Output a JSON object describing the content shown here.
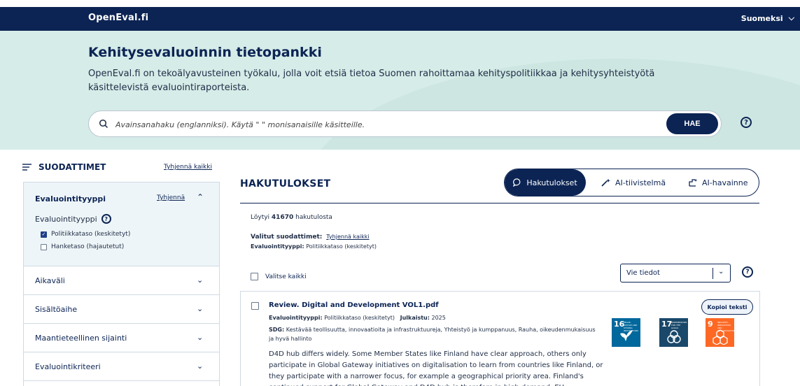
{
  "header": {
    "brand": "OpenEval.fi",
    "language": "Suomeksi"
  },
  "hero": {
    "title": "Kehitysevaluoinnin tietopankki",
    "description": "OpenEval.fi on tekoälyavusteinen työkalu, jolla voit etsiä tietoa Suomen rahoittamaa kehityspolitiikkaa ja kehitysyhteistyötä käsittelevistä evaluointiraporteista.",
    "search_placeholder": "Avainsanahaku (englanniksi). Käytä \" \" monisanaisille käsitteille.",
    "search_button": "HAE"
  },
  "filters": {
    "heading": "SUODATTIMET",
    "clear_all": "Tyhjennä kaikki",
    "open_section": {
      "title": "Evaluointityyppi",
      "clear": "Tyhjennä",
      "sub_label": "Evaluointityyppi",
      "options": [
        {
          "label": "Politiikkataso (keskitetyt)",
          "checked": true
        },
        {
          "label": "Hanketaso (hajautetut)",
          "checked": false
        }
      ]
    },
    "sections": [
      "Aikaväli",
      "Sisältöaihe",
      "Maantieteellinen sijainti",
      "Evaluointikriteeri"
    ]
  },
  "results": {
    "title": "HAKUTULOKSET",
    "tabs": [
      "Hakutulokset",
      "AI-tiivistelmä",
      "AI-havainne"
    ],
    "found_prefix": "Löytyi",
    "found_count": "41670",
    "found_suffix": "hakutulosta",
    "selected_label": "Valitut suodattimet:",
    "selected_clear": "Tyhjennä kaikki",
    "selected_type_label": "Evaluointityyppi:",
    "selected_type_value": "Politiikkataso (keskitetyt)",
    "select_all": "Valitse kaikki",
    "export_value": "Vie tiedot",
    "card": {
      "title": "Review. Digital and Development VOL1.pdf",
      "type_label": "Evaluointityyppi:",
      "type_value": "Politiikkataso (keskitetyt)",
      "published_label": "Julkaistu:",
      "published_value": "2025",
      "sdg_label": "SDG:",
      "sdg_value": "Kestävää teollisuutta, innovaatioita ja infrastruktuureja, Yhteistyö ja kumppanuus, Rauha, oikeudenmukaisuus ja hyvä hallinto",
      "copy_button": "Kopioi teksti",
      "body": "D4D hub differs widely. Some Member States like Finland have clear approach, others only participate in Global Gateway initiatives on digitalisation to learn from countries like Finland, or they participate with a narrower focus, for example a geographical priority area. Finland's continued support for Global Gateway and D4D hub is therefore in high demand. EU interviewees also made",
      "sdg_tiles": [
        {
          "number": "16",
          "label": "PEACE, JUSTICE AND STRONG INSTITUTIONS",
          "color": "#00689d"
        },
        {
          "number": "17",
          "label": "PARTNERSHIPS FOR THE GOALS",
          "color": "#19486a"
        },
        {
          "number": "9",
          "label": "INDUSTRY, INNOVATION AND INFRASTRUCTURE",
          "color": "#fd6925"
        }
      ]
    }
  },
  "icons": [
    "search-icon",
    "help-icon",
    "filter-icon",
    "chevron-down-icon",
    "chevron-up-icon",
    "check-icon",
    "chat-icon",
    "sparkle-icon",
    "insight-icon"
  ]
}
